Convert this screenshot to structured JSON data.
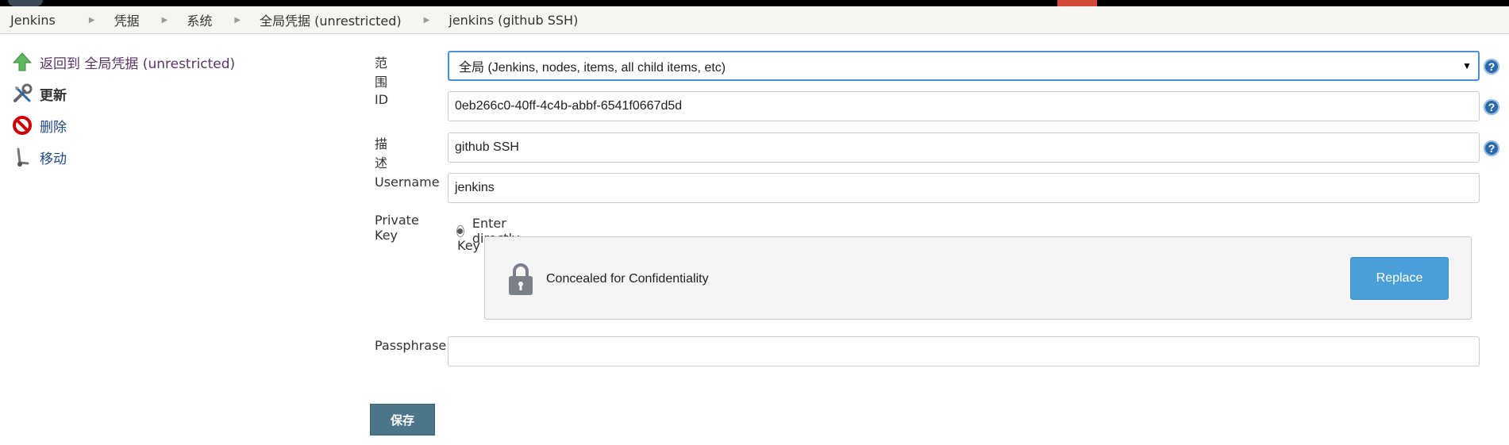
{
  "breadcrumb": [
    "Jenkins",
    "凭据",
    "系统",
    "全局凭据 (unrestricted)",
    "jenkins (github SSH)"
  ],
  "sidebar": {
    "items": [
      {
        "label": "返回到 全局凭据 (unrestricted)",
        "icon": "up-arrow-icon"
      },
      {
        "label": "更新",
        "icon": "wrench-screwdriver-icon"
      },
      {
        "label": "删除",
        "icon": "no-entry-icon"
      },
      {
        "label": "移动",
        "icon": "move-handcart-icon"
      }
    ]
  },
  "form": {
    "scope_label": "范围",
    "scope_value": "全局 (Jenkins, nodes, items, all child items, etc)",
    "id_label": "ID",
    "id_value": "0eb266c0-40ff-4c4b-abbf-6541f0667d5d",
    "description_label": "描述",
    "description_value": "github SSH",
    "username_label": "Username",
    "username_value": "jenkins",
    "private_key_label": "Private Key",
    "enter_directly_label": "Enter directly",
    "key_label": "Key",
    "concealed_text": "Concealed for Confidentiality",
    "replace_label": "Replace",
    "passphrase_label": "Passphrase",
    "passphrase_value": "",
    "help_glyph": "?",
    "dropdown_glyph": "▼"
  },
  "save_label": "保存",
  "colors": {
    "accent": "#4a90d9",
    "save_button": "#4b758b",
    "replace_button": "#4a9fd8",
    "link": "#204a87",
    "topbar_red": "#d24939"
  }
}
